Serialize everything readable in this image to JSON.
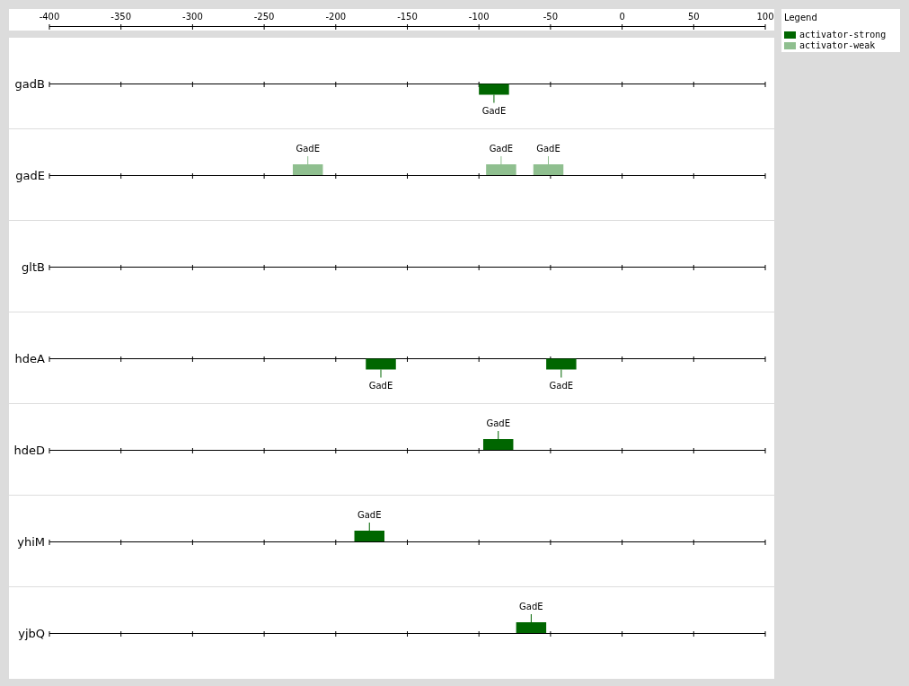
{
  "axis": {
    "ticks": [
      "-400",
      "-350",
      "-300",
      "-250",
      "-200",
      "-150",
      "-100",
      "-50",
      "0",
      "50",
      "100"
    ]
  },
  "tracks": [
    {
      "gene": "gadB",
      "sites": [
        {
          "label": "GadE",
          "color": "#006600"
        }
      ]
    },
    {
      "gene": "gadE",
      "sites": [
        {
          "label": "GadE",
          "color": "#8fbf8f"
        },
        {
          "label": "GadE",
          "color": "#8fbf8f"
        },
        {
          "label": "GadE",
          "color": "#8fbf8f"
        }
      ]
    },
    {
      "gene": "gltB"
    },
    {
      "gene": "hdeA",
      "sites": [
        {
          "label": "GadE",
          "color": "#006600"
        },
        {
          "label": "GadE",
          "color": "#006600"
        }
      ]
    },
    {
      "gene": "hdeD",
      "sites": [
        {
          "label": "GadE",
          "color": "#006600"
        }
      ]
    },
    {
      "gene": "yhiM",
      "sites": [
        {
          "label": "GadE",
          "color": "#006600"
        }
      ]
    },
    {
      "gene": "yjbQ",
      "sites": [
        {
          "label": "GadE",
          "color": "#006600"
        }
      ]
    }
  ],
  "legend": {
    "title": "Legend",
    "items": [
      {
        "label": "activator-strong",
        "color": "#006600"
      },
      {
        "label": "activator-weak",
        "color": "#8fbf8f"
      }
    ]
  }
}
